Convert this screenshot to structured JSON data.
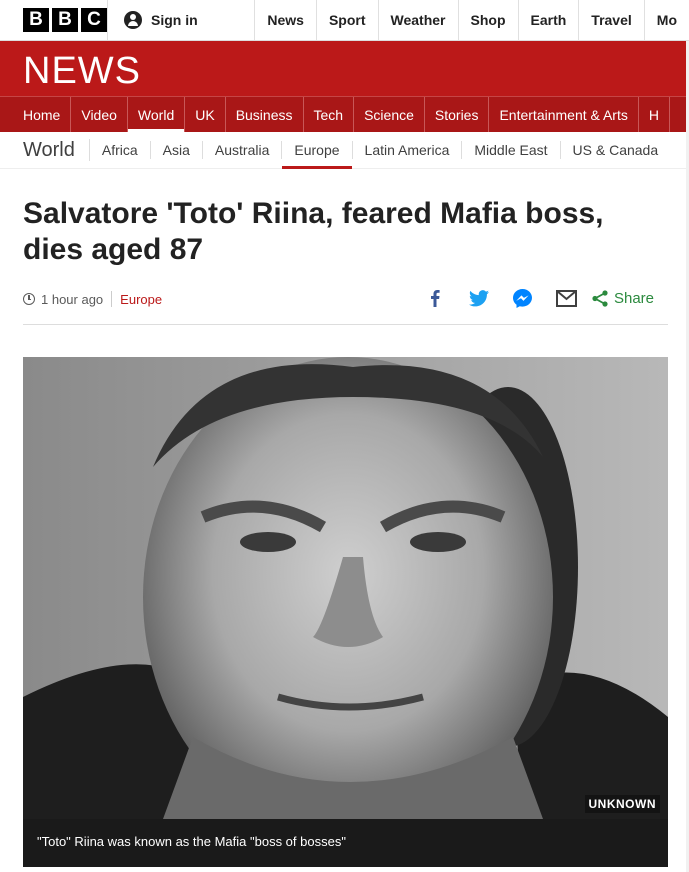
{
  "brand": {
    "letters": [
      "B",
      "B",
      "C"
    ],
    "news_wordmark": "NEWS"
  },
  "account": {
    "signin_label": "Sign in"
  },
  "top_nav": [
    "News",
    "Sport",
    "Weather",
    "Shop",
    "Earth",
    "Travel",
    "Mo"
  ],
  "main_nav": {
    "items": [
      "Home",
      "Video",
      "World",
      "UK",
      "Business",
      "Tech",
      "Science",
      "Stories",
      "Entertainment & Arts",
      "H"
    ],
    "active": "World"
  },
  "sub_nav": {
    "section": "World",
    "items": [
      "Africa",
      "Asia",
      "Australia",
      "Europe",
      "Latin America",
      "Middle East",
      "US & Canada"
    ],
    "active": "Europe"
  },
  "article": {
    "headline": "Salvatore 'Toto' Riina, feared Mafia boss, dies aged 87",
    "timestamp": "1 hour ago",
    "section_link": "Europe",
    "share_label": "Share",
    "image": {
      "copyright": "UNKNOWN",
      "caption": "\"Toto\" Riina was known as the Mafia \"boss of bosses\""
    }
  },
  "colors": {
    "brand_red": "#bb1919",
    "nav_red": "#a91717",
    "share_green": "#2b8a3e",
    "facebook": "#3b5998",
    "twitter": "#1da1f2",
    "messenger": "#0084ff"
  },
  "icons": [
    "user-icon",
    "clock-icon",
    "facebook-icon",
    "twitter-icon",
    "messenger-icon",
    "email-icon",
    "share-icon"
  ]
}
